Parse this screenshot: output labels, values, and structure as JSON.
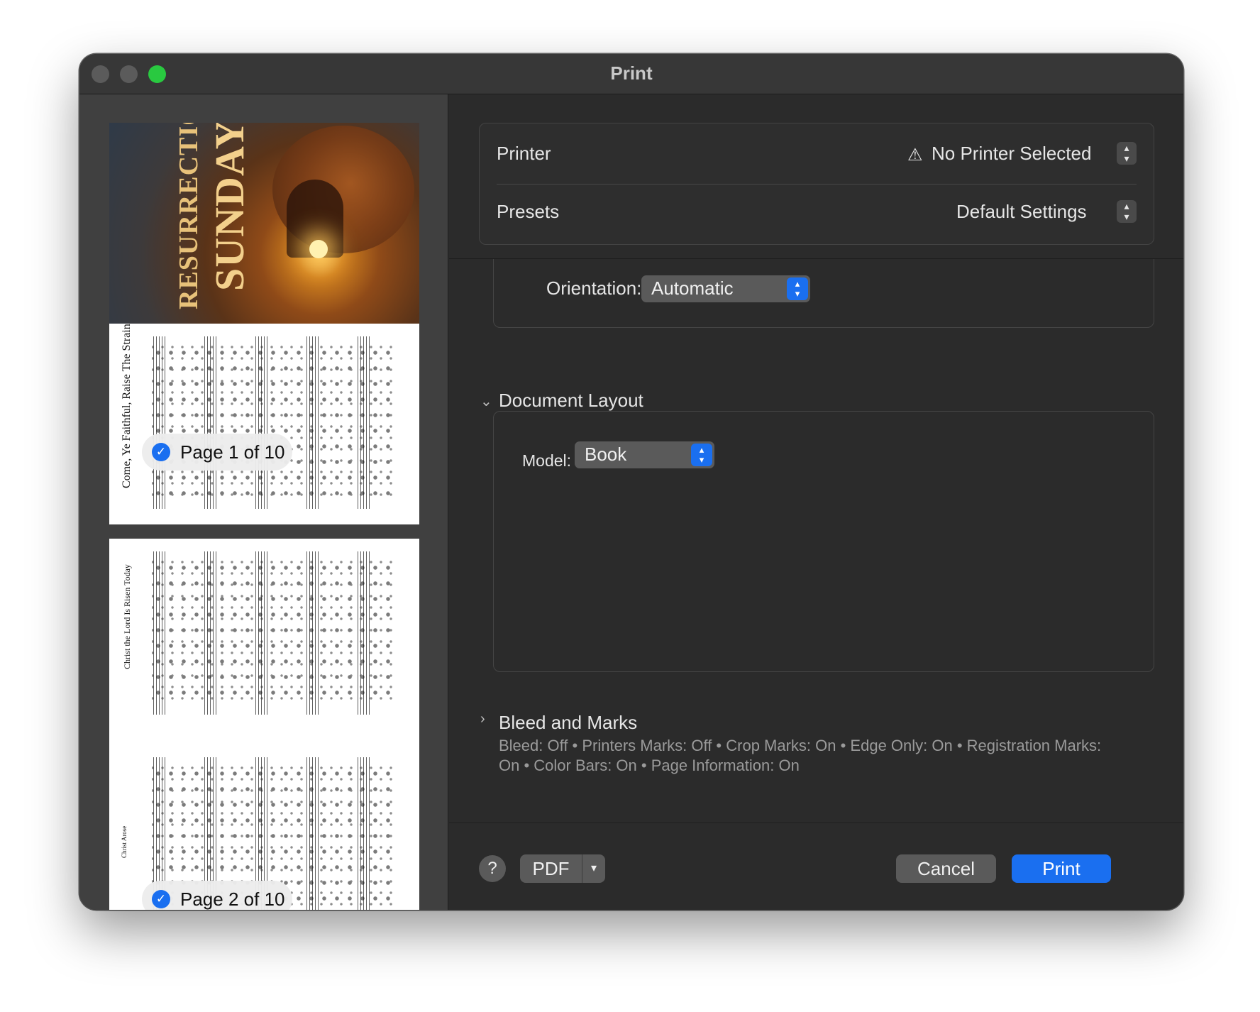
{
  "window": {
    "title": "Print"
  },
  "preview": {
    "cover_line1": "RESURRECTION",
    "cover_line2": "SUNDAY",
    "song1_title": "Come, Ye Faithful, Raise The Strain",
    "song2_title": "Christ the Lord Is Risen Today",
    "song3_title": "Christ Arose",
    "page1_label": "Page 1 of 10",
    "page2_label": "Page 2 of 10",
    "check_glyph": "✓"
  },
  "printer_section": {
    "printer_label": "Printer",
    "printer_value": "No Printer Selected",
    "warning_icon": "⚠",
    "presets_label": "Presets",
    "presets_value": "Default Settings"
  },
  "paper_section": {
    "orientation_label": "Orientation:",
    "orientation_value": "Automatic"
  },
  "document_layout": {
    "title": "Document Layout",
    "expanded": true,
    "model_label": "Model:",
    "model_value": "Book"
  },
  "bleed_marks": {
    "title": "Bleed and Marks",
    "expanded": false,
    "summary": "Bleed: Off • Printers Marks: Off • Crop Marks: On • Edge Only: On • Registration Marks: On • Color Bars: On • Page Information: On"
  },
  "footer": {
    "help_label": "?",
    "pdf_label": "PDF",
    "cancel_label": "Cancel",
    "print_label": "Print"
  },
  "colors": {
    "accent": "#1a6ff0",
    "window_bg": "#2b2b2b",
    "zoom_button": "#29c940"
  }
}
